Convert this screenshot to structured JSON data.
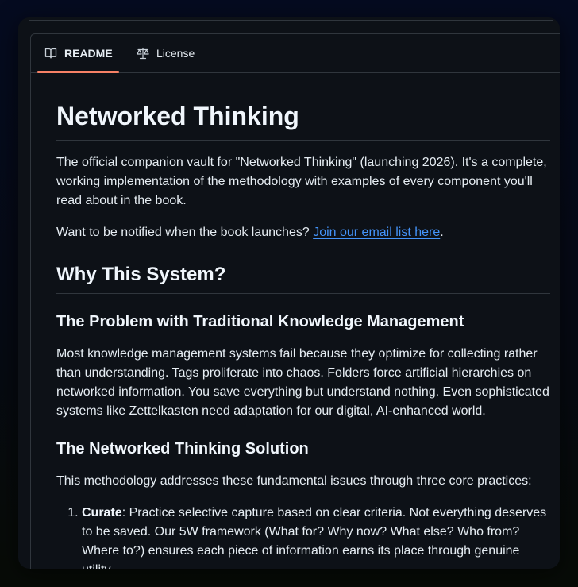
{
  "tabs": {
    "readme": "README",
    "license": "License"
  },
  "icons": {
    "readme": "book-icon",
    "license": "scale-icon",
    "outline": "list-unordered-icon"
  },
  "colors": {
    "background": "#0d1117",
    "text": "#e6edf3",
    "border": "#30363d",
    "link": "#4493f8",
    "active_tab_underline": "#f78166"
  },
  "readme": {
    "title": "Networked Thinking",
    "intro": "The official companion vault for \"Networked Thinking\" (launching 2026). It's a complete, working implementation of the methodology with examples of every component you'll read about in the book.",
    "notify_text": "Want to be notified when the book launches? ",
    "notify_link": "Join our email list here",
    "notify_end": ".",
    "why_heading": "Why This System?",
    "problem_heading": "The Problem with Traditional Knowledge Management",
    "problem_text": "Most knowledge management systems fail because they optimize for collecting rather than understanding. Tags proliferate into chaos. Folders force artificial hierarchies on networked information. You save everything but understand nothing. Even sophisticated systems like Zettelkasten need adaptation for our digital, AI-enhanced world.",
    "solution_heading": "The Networked Thinking Solution",
    "solution_text": "This methodology addresses these fundamental issues through three core practices:",
    "practices": [
      {
        "name": "Curate",
        "text": ": Practice selective capture based on clear criteria. Not everything deserves to be saved. Our 5W framework (What for? Why now? What else? Who from? Where to?) ensures each piece of information earns its place through genuine utility."
      }
    ]
  }
}
